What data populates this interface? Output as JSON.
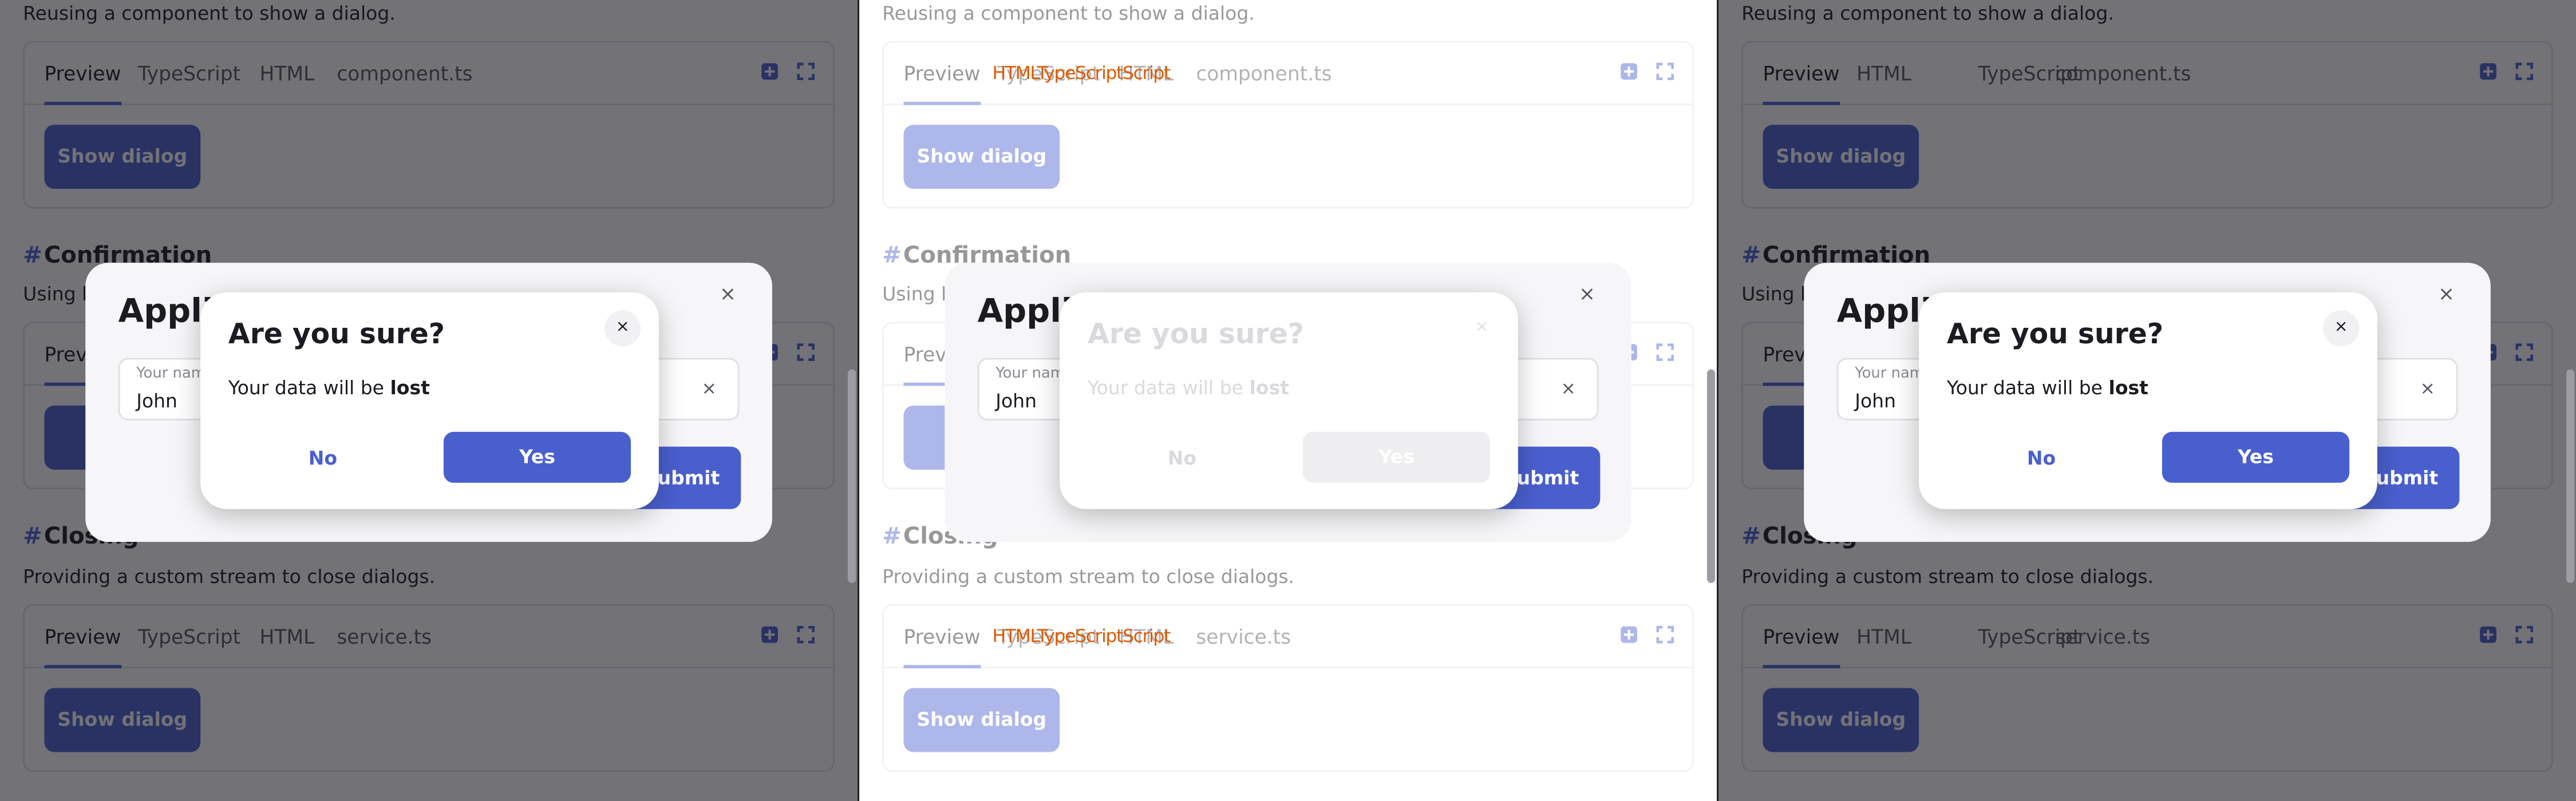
{
  "panels": [
    {
      "section1_desc": "Reusing a component to show a dialog.",
      "tabs1": [
        "Preview",
        "TypeScript",
        "HTML",
        "component.ts"
      ],
      "heading2": "Confirmation",
      "section2_desc": "Using b",
      "tabs2": [
        "Previ"
      ],
      "bg_button_partial": "Sh",
      "heading3": "Closing",
      "section3_desc": "Providing a custom stream to close dialogs.",
      "tabs3": [
        "Preview",
        "TypeScript",
        "HTML",
        "service.ts"
      ]
    },
    {
      "section1_desc": "Reusing a component to show a dialog.",
      "tabs1": [
        "Preview",
        "TypeScript",
        "HTML",
        "component.ts"
      ],
      "heading2": "Confirmation",
      "section2_desc": "Using b",
      "tabs2": [
        "Previ"
      ],
      "bg_button_partial": "Sh",
      "heading3": "Closing",
      "section3_desc": "Providing a custom stream to close dialogs.",
      "tabs3": [
        "Preview",
        "TypeScript",
        "HTML",
        "service.ts"
      ]
    },
    {
      "section1_desc": "Reusing a component to show a dialog.",
      "tabs1": [
        "Preview",
        "HTML",
        "TypeScript",
        "component.ts"
      ],
      "heading2": "Confirmation",
      "section2_desc": "Using b",
      "tabs2": [
        "Previ"
      ],
      "bg_button_partial": "Sh",
      "heading3": "Closing",
      "section3_desc": "Providing a custom stream to close dialogs.",
      "tabs3": [
        "Preview",
        "HTML",
        "TypeScript",
        "service.ts"
      ]
    }
  ],
  "show_dialog_label": "Show dialog",
  "hash": "#",
  "bg_dialog": {
    "title": "Appli",
    "field_label": "Your nam",
    "field_value": "John",
    "submit_label": "Submit",
    "clear_icon": "×",
    "close_icon": "×"
  },
  "dialog": {
    "title": "Are you sure?",
    "text_prefix": "Your data will be ",
    "text_bold": "lost",
    "no_label": "No",
    "yes_label": "Yes",
    "close_icon": "×"
  },
  "ghost_text": "HTMLTypeScriptScript",
  "icons": {
    "expand": "expand-icon",
    "fullscreen": "fullscreen-icon"
  },
  "colors": {
    "accent": "#4a5fce",
    "text": "#1b1c22",
    "muted": "#55565e"
  }
}
